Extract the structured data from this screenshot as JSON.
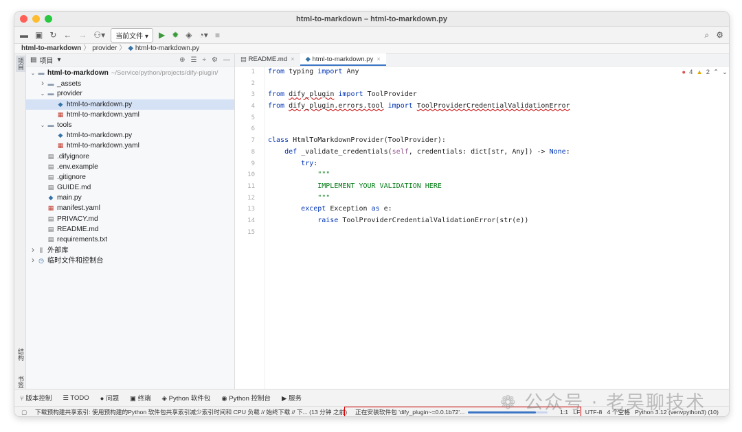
{
  "window": {
    "title": "html-to-markdown – html-to-markdown.py"
  },
  "toolbar": {
    "run_config": "当前文件 ▾",
    "icons": [
      "folder-icon",
      "save-icon",
      "sync-icon",
      "back-icon",
      "forward-icon",
      "vcs-icon",
      "run-icon",
      "debug-icon",
      "coverage-icon",
      "profile-icon",
      "stop-icon",
      "search-icon",
      "settings-icon"
    ]
  },
  "breadcrumbs": [
    "html-to-markdown",
    "provider",
    "html-to-markdown.py"
  ],
  "left_strip": {
    "project": "项目",
    "structure": "结构",
    "bookmarks": "书签"
  },
  "project_panel": {
    "title": "项目",
    "tree": [
      {
        "level": 0,
        "arrow": "v",
        "icon": "folder",
        "name": "html-to-markdown",
        "hint": "~/Service/python/projects/dify-plugin/",
        "bold": true
      },
      {
        "level": 1,
        "arrow": ">",
        "icon": "folder",
        "name": "_assets"
      },
      {
        "level": 1,
        "arrow": "v",
        "icon": "folder",
        "name": "provider"
      },
      {
        "level": 2,
        "arrow": "",
        "icon": "py",
        "name": "html-to-markdown.py",
        "selected": true
      },
      {
        "level": 2,
        "arrow": "",
        "icon": "yaml",
        "name": "html-to-markdown.yaml"
      },
      {
        "level": 1,
        "arrow": "v",
        "icon": "folder",
        "name": "tools"
      },
      {
        "level": 2,
        "arrow": "",
        "icon": "py",
        "name": "html-to-markdown.py"
      },
      {
        "level": 2,
        "arrow": "",
        "icon": "yaml",
        "name": "html-to-markdown.yaml"
      },
      {
        "level": 1,
        "arrow": "",
        "icon": "md",
        "name": ".difyignore"
      },
      {
        "level": 1,
        "arrow": "",
        "icon": "md",
        "name": ".env.example"
      },
      {
        "level": 1,
        "arrow": "",
        "icon": "md",
        "name": ".gitignore"
      },
      {
        "level": 1,
        "arrow": "",
        "icon": "md",
        "name": "GUIDE.md"
      },
      {
        "level": 1,
        "arrow": "",
        "icon": "py",
        "name": "main.py"
      },
      {
        "level": 1,
        "arrow": "",
        "icon": "yaml",
        "name": "manifest.yaml"
      },
      {
        "level": 1,
        "arrow": "",
        "icon": "md",
        "name": "PRIVACY.md"
      },
      {
        "level": 1,
        "arrow": "",
        "icon": "md",
        "name": "README.md"
      },
      {
        "level": 1,
        "arrow": "",
        "icon": "md",
        "name": "requirements.txt"
      },
      {
        "level": 0,
        "arrow": ">",
        "icon": "lib",
        "name": "外部库"
      },
      {
        "level": 0,
        "arrow": ">",
        "icon": "scratch",
        "name": "临时文件和控制台"
      }
    ]
  },
  "editor": {
    "tabs": [
      {
        "label": "README.md",
        "active": false
      },
      {
        "label": "html-to-markdown.py",
        "active": true
      }
    ],
    "inspections": {
      "errors": "4",
      "warnings": "2"
    },
    "line_numbers": [
      "1",
      "2",
      "3",
      "4",
      "5",
      "6",
      "7",
      "8",
      "9",
      "10",
      "11",
      "12",
      "13",
      "14",
      "15"
    ],
    "lines": [
      "from typing import Any",
      "",
      "from dify_plugin import ToolProvider",
      "from dify_plugin.errors.tool import ToolProviderCredentialValidationError",
      "",
      "",
      "class HtmlToMarkdownProvider(ToolProvider):",
      "    def _validate_credentials(self, credentials: dict[str, Any]) -> None:",
      "        try:",
      "            \"\"\"",
      "            IMPLEMENT YOUR VALIDATION HERE",
      "            \"\"\"",
      "        except Exception as e:",
      "            raise ToolProviderCredentialValidationError(str(e))",
      ""
    ]
  },
  "tool_windows": [
    "版本控制",
    "TODO",
    "问题",
    "终端",
    "Python 软件包",
    "Python 控制台",
    "服务"
  ],
  "status": {
    "left": "下载预构建共享索引: 使用预构建的Python 软件包共享索引减少索引时间和 CPU 负载 // 始终下载 // 下... (13 分钟 之前)",
    "progress_text": "正在安装软件包 'dify_plugin~=0.0.1b72'...",
    "progress": 0.85,
    "position": "1:1",
    "line_sep": "LF",
    "encoding": "UTF-8",
    "indent": "4 个空格",
    "interpreter": "Python 3.12 (venvpython3) (10)"
  },
  "watermark": "公众号 · 老吴聊技术"
}
